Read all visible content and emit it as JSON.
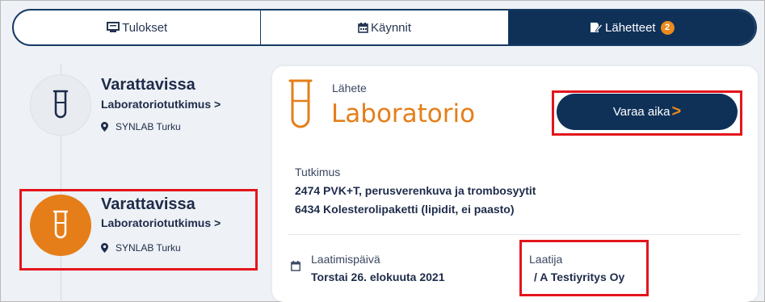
{
  "tabs": [
    {
      "label": "Tulokset",
      "icon": "monitor-icon"
    },
    {
      "label": "Käynnit",
      "icon": "calendar-icon"
    },
    {
      "label": "Lähetteet",
      "icon": "document-pen-icon",
      "badge": "2",
      "active": true
    }
  ],
  "list": [
    {
      "status": "Varattavissa",
      "type": "Laboratoriotutkimus",
      "chevron": ">",
      "location": "SYNLAB Turku",
      "icon": "test-tube-icon"
    },
    {
      "status": "Varattavissa",
      "type": "Laboratoriotutkimus",
      "chevron": ">",
      "location": "SYNLAB Turku",
      "icon": "test-tube-icon",
      "selected": true
    }
  ],
  "detail": {
    "kind_label": "Lähete",
    "title": "Laboratorio",
    "book_button": "Varaa aika",
    "book_chevron": ">",
    "tests_label": "Tutkimus",
    "tests": [
      "2474 PVK+T, perusverenkuva ja trombosyytit",
      "6434 Kolesterolipaketti (lipidit, ei paasto)"
    ],
    "date_label": "Laatimispäivä",
    "date_value": "Torstai 26. elokuuta 2021",
    "author_label": "Laatija",
    "author_value": "/ A Testiyritys Oy"
  },
  "colors": {
    "navy": "#0f3158",
    "accent": "#e57e19",
    "highlight": "#e3151c"
  }
}
